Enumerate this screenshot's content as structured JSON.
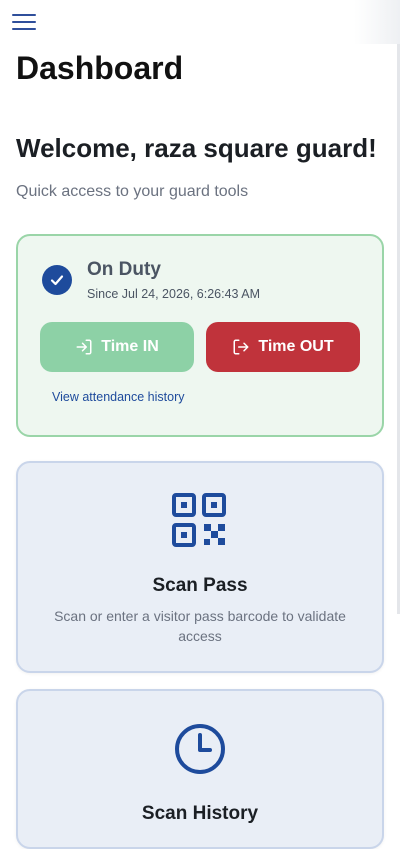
{
  "header": {
    "menu_icon": "hamburger-menu-icon"
  },
  "page": {
    "title": "Dashboard",
    "welcome": "Welcome, raza square guard!",
    "subtitle": "Quick access to your guard tools"
  },
  "duty": {
    "status": "On Duty",
    "since": "Since Jul 24, 2026, 6:26:43 AM",
    "time_in_label": "Time IN",
    "time_out_label": "Time OUT",
    "history_link": "View attendance history",
    "colors": {
      "card_border": "#9ad5a8",
      "time_in": "#8dd1a6",
      "time_out": "#c0333b",
      "badge": "#1e4b9c"
    }
  },
  "tools": {
    "scan_pass": {
      "icon": "qr-code-icon",
      "title": "Scan Pass",
      "description": "Scan or enter a visitor pass barcode to validate access"
    },
    "scan_history": {
      "icon": "clock-icon",
      "title": "Scan History"
    }
  },
  "colors": {
    "accent": "#1e4b9c"
  }
}
